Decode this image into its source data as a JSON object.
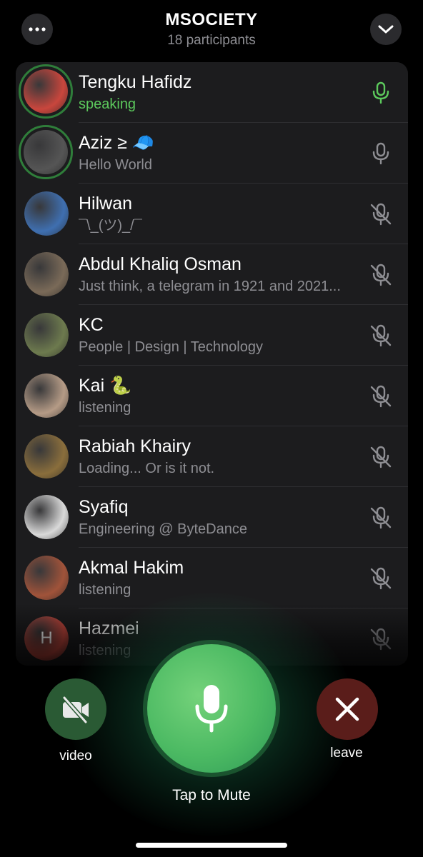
{
  "header": {
    "title": "MSOCIETY",
    "subtitle": "18 participants"
  },
  "participants": [
    {
      "name": "Tengku Hafidz",
      "status": "speaking",
      "speaking": true,
      "mic": "on",
      "avatar_color": "#c9463d"
    },
    {
      "name": "Aziz ≥ 🧢",
      "status": "Hello World",
      "speaking": false,
      "mic": "on",
      "avatar_color": "#555555"
    },
    {
      "name": "Hilwan",
      "status": "¯\\_(ツ)_/¯",
      "speaking": false,
      "mic": "muted",
      "avatar_color": "#3f6fb0"
    },
    {
      "name": "Abdul Khaliq Osman",
      "status": "Just think, a telegram in 1921 and 2021...",
      "speaking": false,
      "mic": "muted",
      "avatar_color": "#7a6a58"
    },
    {
      "name": "KC",
      "status": "People | Design | Technology",
      "speaking": false,
      "mic": "muted",
      "avatar_color": "#6d7a4e"
    },
    {
      "name": "Kai 🐍",
      "status": "listening",
      "speaking": false,
      "mic": "muted",
      "avatar_color": "#b59b86"
    },
    {
      "name": "Rabiah Khairy",
      "status": "Loading... Or is it not.",
      "speaking": false,
      "mic": "muted",
      "avatar_color": "#8a6e3c"
    },
    {
      "name": "Syafiq",
      "status": "Engineering @ ByteDance",
      "speaking": false,
      "mic": "muted",
      "avatar_color": "#d9d9d9"
    },
    {
      "name": "Akmal Hakim",
      "status": "listening",
      "speaking": false,
      "mic": "muted",
      "avatar_color": "#a0533a"
    },
    {
      "name": "Hazmei",
      "status": "listening",
      "speaking": false,
      "mic": "muted",
      "avatar_color": "#c0463c",
      "initial": "H"
    }
  ],
  "controls": {
    "video_label": "video",
    "leave_label": "leave",
    "main_label": "Tap to Mute"
  },
  "colors": {
    "accent_green": "#5cc95c",
    "leave_red": "#5a1d1a",
    "list_bg": "#1c1c1e"
  },
  "icons": {
    "more": "more-icon",
    "collapse": "chevron-down-icon",
    "mic_on": "mic-icon",
    "mic_muted": "mic-muted-icon",
    "video_off": "video-off-icon",
    "leave": "close-icon"
  }
}
